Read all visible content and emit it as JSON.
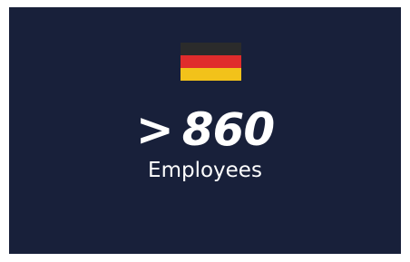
{
  "stat": {
    "flag_icon": "germany-flag-icon",
    "flag_colors": [
      "#2b2b2b",
      "#e02c2c",
      "#f2c21a"
    ],
    "prefix": ">",
    "value": "860",
    "label": "Employees"
  },
  "colors": {
    "background": "#18203a",
    "text": "#ffffff"
  }
}
